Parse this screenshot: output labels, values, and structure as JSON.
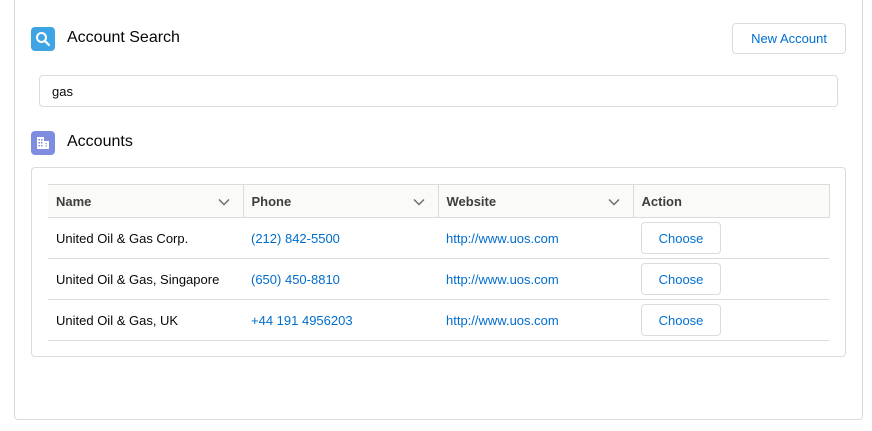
{
  "search_section": {
    "title": "Account Search",
    "icon": "search-icon",
    "new_button_label": "New Account",
    "query": "gas"
  },
  "accounts_section": {
    "title": "Accounts",
    "icon": "account-icon",
    "columns": [
      "Name",
      "Phone",
      "Website",
      "Action"
    ],
    "rows": [
      {
        "name": "United Oil & Gas Corp.",
        "phone": "(212) 842-5500",
        "website": "http://www.uos.com",
        "action": "Choose"
      },
      {
        "name": "United Oil & Gas, Singapore",
        "phone": "(650) 450-8810",
        "website": "http://www.uos.com",
        "action": "Choose"
      },
      {
        "name": "United Oil & Gas, UK",
        "phone": "+44 191 4956203",
        "website": "http://www.uos.com",
        "action": "Choose"
      }
    ]
  },
  "colors": {
    "search_icon_bg": "#3fa4e4",
    "account_icon_bg": "#7f8de1",
    "link": "#006dcc",
    "brand": "#0070d2"
  }
}
